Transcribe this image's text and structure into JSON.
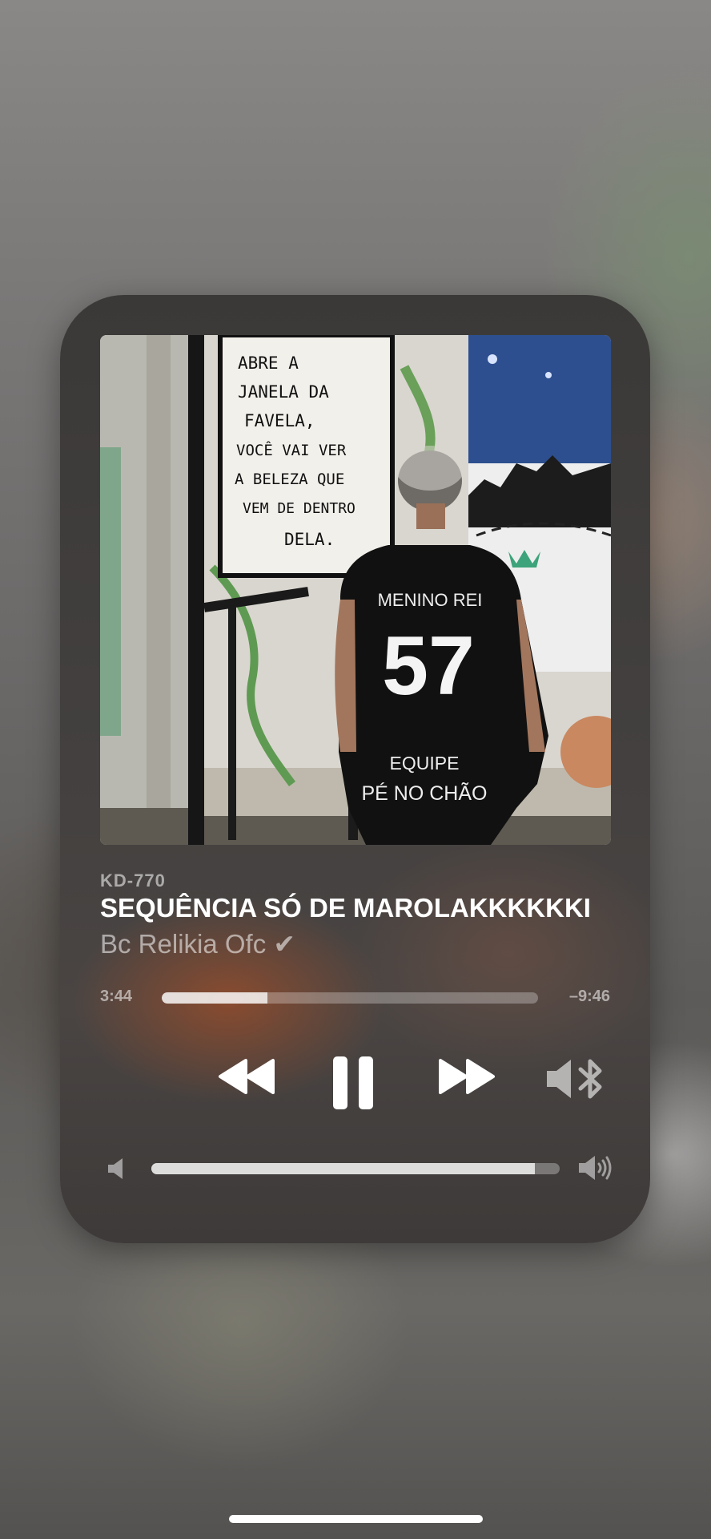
{
  "now_playing": {
    "code_label": "KD-770",
    "title": "SEQUÊNCIA SÓ DE MAROLAKKKKKKI",
    "artist": "Bc Relikia Ofc ✔",
    "elapsed": "3:44",
    "remaining": "–9:46",
    "progress": 0.28,
    "artwork": {
      "wall_text": [
        "ABRE A",
        "JANELA DA",
        "FAVELA,",
        "VOCÊ VAI VER",
        "A BELEZA QUE",
        "VEM DE DENTRO",
        "DELA."
      ],
      "jersey_top": "MENINO REI",
      "jersey_number": "57",
      "jersey_bottom": [
        "EQUIPE",
        "PÉ NO CHÃO"
      ]
    }
  },
  "controls": {
    "rewind_icon": "rewind-icon",
    "pause_icon": "pause-icon",
    "forward_icon": "fast-forward-icon",
    "route_icon": "bluetooth-speaker-icon"
  },
  "volume": {
    "level": 0.94,
    "min_icon": "speaker-min-icon",
    "max_icon": "speaker-max-icon"
  },
  "colors": {
    "accent": "#ffffff",
    "card_bg": "#3f3d3c",
    "secondary_text": "#9e9c9b"
  }
}
